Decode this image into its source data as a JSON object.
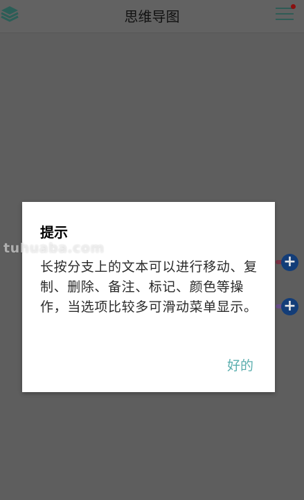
{
  "app": {
    "title": "思维导图"
  },
  "icons": {
    "left": "layers-icon",
    "right": "menu-icon",
    "node_add": "add-node-icon",
    "node_add_glyph": "+"
  },
  "colors": {
    "accent_teal": "#5aaeae",
    "node_blue": "#133d78",
    "branch_red": "#7a3345",
    "branch_purple": "#6a4f8a",
    "overlay": "#5e5e5e"
  },
  "watermark": "tuhuaba.com",
  "dialog": {
    "title": "提示",
    "message": "长按分支上的文本可以进行移动、复制、删除、备注、标记、颜色等操作，当选项比较多可滑动菜单显示。",
    "ok_label": "好的"
  }
}
